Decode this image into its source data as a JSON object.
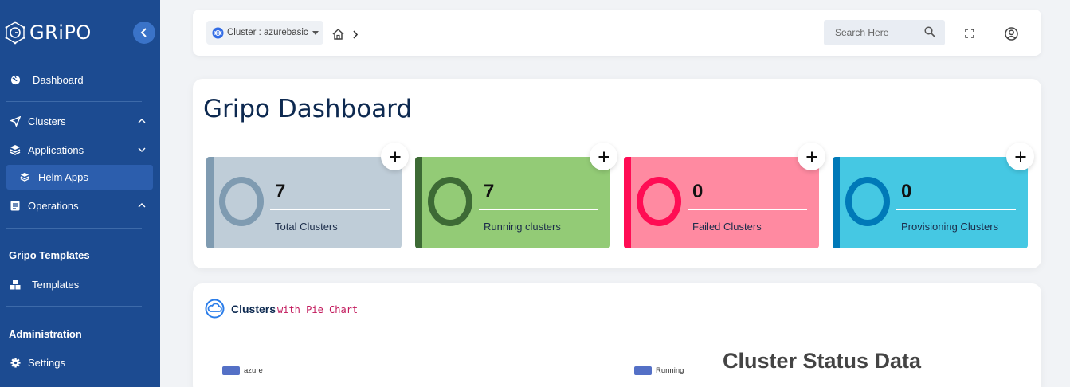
{
  "sidebar": {
    "logo": "GRiPO",
    "items": {
      "dashboard": "Dashboard",
      "clusters": "Clusters",
      "applications": "Applications",
      "helm_apps": "Helm Apps",
      "operations": "Operations",
      "templates": "Templates",
      "settings": "Settings"
    },
    "sections": {
      "gripo_templates": "Gripo Templates",
      "administration": "Administration"
    }
  },
  "topbar": {
    "cluster_select": "Cluster : azurebasic",
    "search_placeholder": "Search Here"
  },
  "dashboard": {
    "title": "Gripo Dashboard",
    "stats": [
      {
        "value": "7",
        "label": "Total Clusters",
        "bg": "#bfcdd8",
        "accent": "#7f9bb1"
      },
      {
        "value": "7",
        "label": "Running clusters",
        "bg": "#93cb76",
        "accent": "#3d6a35"
      },
      {
        "value": "0",
        "label": "Failed Clusters",
        "bg": "#ff8aa1",
        "accent": "#ff0d54"
      },
      {
        "value": "0",
        "label": "Provisioning Clusters",
        "bg": "#45c8e3",
        "accent": "#0079b8"
      }
    ]
  },
  "clusters_card": {
    "title": "Clusters",
    "subtitle": "with Pie Chart",
    "legend_left": "azure",
    "legend_right": "Running",
    "status_title": "Cluster Status Data"
  },
  "colors": {
    "sidebar_bg": "#1c4b91",
    "title_color": "#0d2950",
    "legend_color": "#5470c6"
  }
}
